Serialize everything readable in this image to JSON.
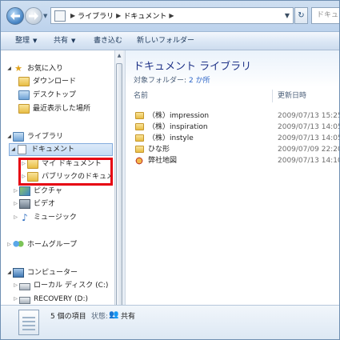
{
  "address": {
    "crumbs": [
      "ライブラリ",
      "ドキュメント"
    ],
    "search_placeholder": "ドキュメ"
  },
  "toolbar": {
    "organize": "整理",
    "share": "共有",
    "burn": "書き込む",
    "new_folder": "新しいフォルダー"
  },
  "nav": {
    "favorites": {
      "label": "お気に入り",
      "items": [
        "ダウンロード",
        "デスクトップ",
        "最近表示した場所"
      ]
    },
    "libraries": {
      "label": "ライブラリ",
      "documents": "ドキュメント",
      "documents_children": [
        "マイ ドキュメント",
        "パブリックのドキュメント"
      ],
      "others": [
        "ピクチャ",
        "ビデオ",
        "ミュージック"
      ]
    },
    "homegroup": "ホームグループ",
    "computer": {
      "label": "コンピューター",
      "drives": [
        "ローカル ディスク (C:)",
        "RECOVERY (D:)"
      ]
    }
  },
  "content": {
    "title": "ドキュメント ライブラリ",
    "subtitle_label": "対象フォルダー:",
    "subtitle_link": "2 か所",
    "columns": {
      "name": "名前",
      "modified": "更新日時"
    },
    "files": [
      {
        "name": "（株）impression",
        "date": "2009/07/13 15:25",
        "icon": "folder-icon"
      },
      {
        "name": "（株）inspiration",
        "date": "2009/07/13 14:05",
        "icon": "folder-icon"
      },
      {
        "name": "（株）instyle",
        "date": "2009/07/13 14:05",
        "icon": "folder-icon"
      },
      {
        "name": "ひな形",
        "date": "2009/07/09 22:20",
        "icon": "folder-icon"
      },
      {
        "name": "弊社地図",
        "date": "2009/07/13 14:10",
        "icon": "shortcut-icon"
      }
    ]
  },
  "details": {
    "count": "5 個の項目",
    "state_label": "状態:",
    "state_value": "共有"
  }
}
